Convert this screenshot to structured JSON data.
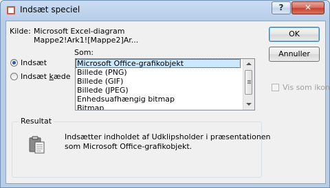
{
  "window": {
    "title": "Indsæt speciel",
    "help_label": "?",
    "close_label": "✕"
  },
  "source": {
    "label": "Kilde:",
    "line1": "Microsoft Excel-diagram",
    "line2": "Mappe2!Ark1![Mappe2]Ar..."
  },
  "buttons": {
    "ok": "OK",
    "cancel": "Annuller"
  },
  "options": {
    "paste_label": "Indsæt",
    "paste_link_prefix": "Indsæt ",
    "paste_link_underlined": "k",
    "paste_link_suffix": "æde",
    "paste_selected": true
  },
  "as": {
    "label": "Som:",
    "items": [
      "Microsoft Office-grafikobjekt",
      "Billede (PNG)",
      "Billede (GIF)",
      "Billede (JPEG)",
      "Enhedsuafhængig bitmap",
      "Bitmap"
    ],
    "selected_index": 0
  },
  "display_as_icon": {
    "label": "Vis som ikon",
    "checked": false,
    "enabled": false
  },
  "result": {
    "label": "Resultat",
    "text_line1": "Indsætter indholdet af Udklipsholder i præsentationen",
    "text_line2": "som Microsoft Office-grafikobjekt.",
    "icon": "clipboard-paste-icon"
  }
}
